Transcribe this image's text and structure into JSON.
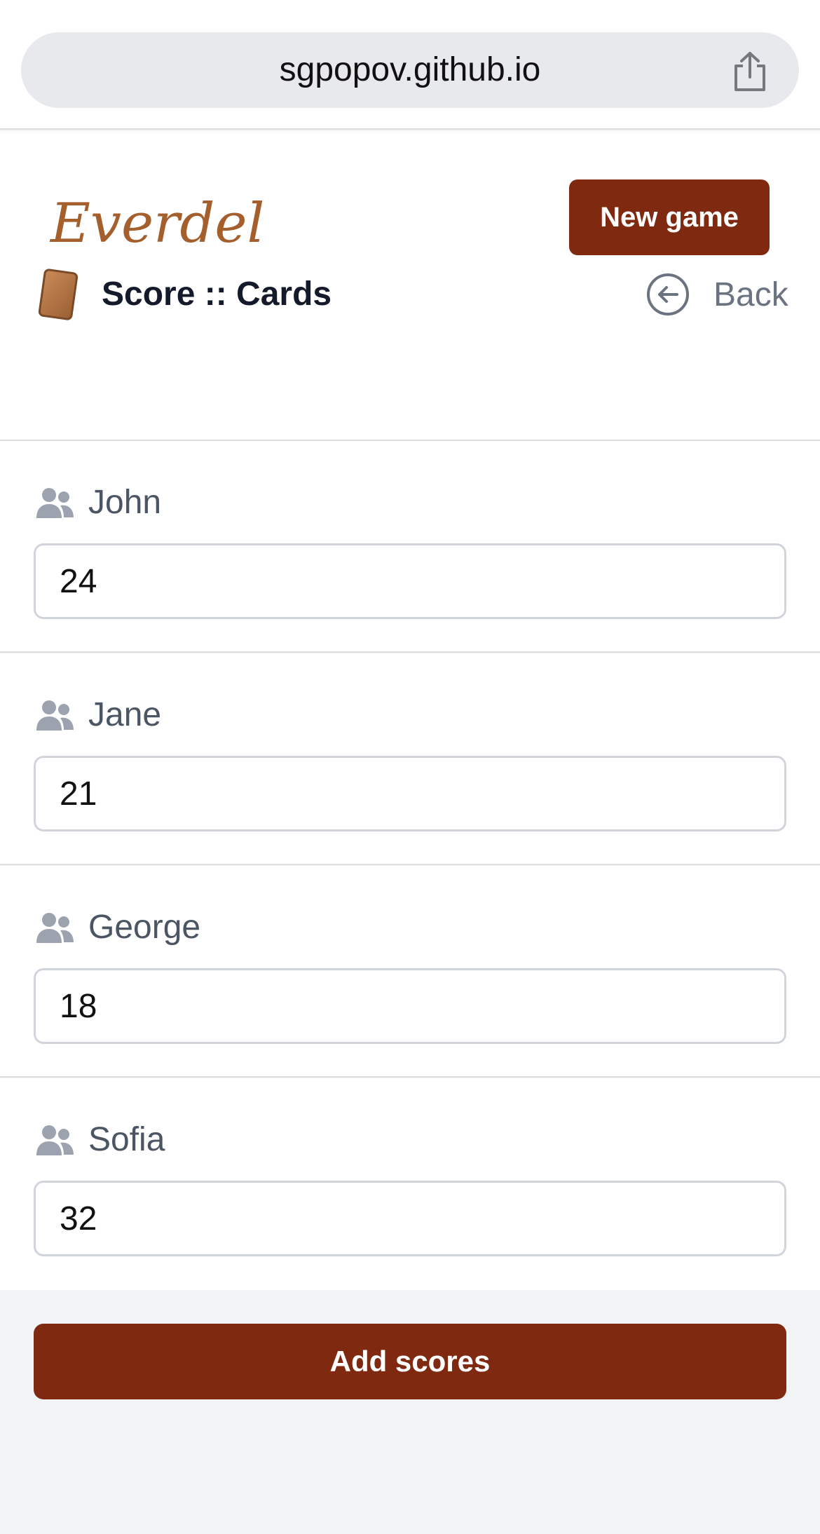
{
  "browser": {
    "url": "sgpopov.github.io"
  },
  "header": {
    "logo_text": "Everdell",
    "new_game_label": "New game"
  },
  "page": {
    "title": "Score :: Cards",
    "back_label": "Back"
  },
  "players": [
    {
      "name": "John",
      "score": "24"
    },
    {
      "name": "Jane",
      "score": "21"
    },
    {
      "name": "George",
      "score": "18"
    },
    {
      "name": "Sofia",
      "score": "32"
    }
  ],
  "actions": {
    "add_scores_label": "Add scores"
  },
  "colors": {
    "brand": "#7f2a10",
    "logo": "#a45f2c"
  }
}
